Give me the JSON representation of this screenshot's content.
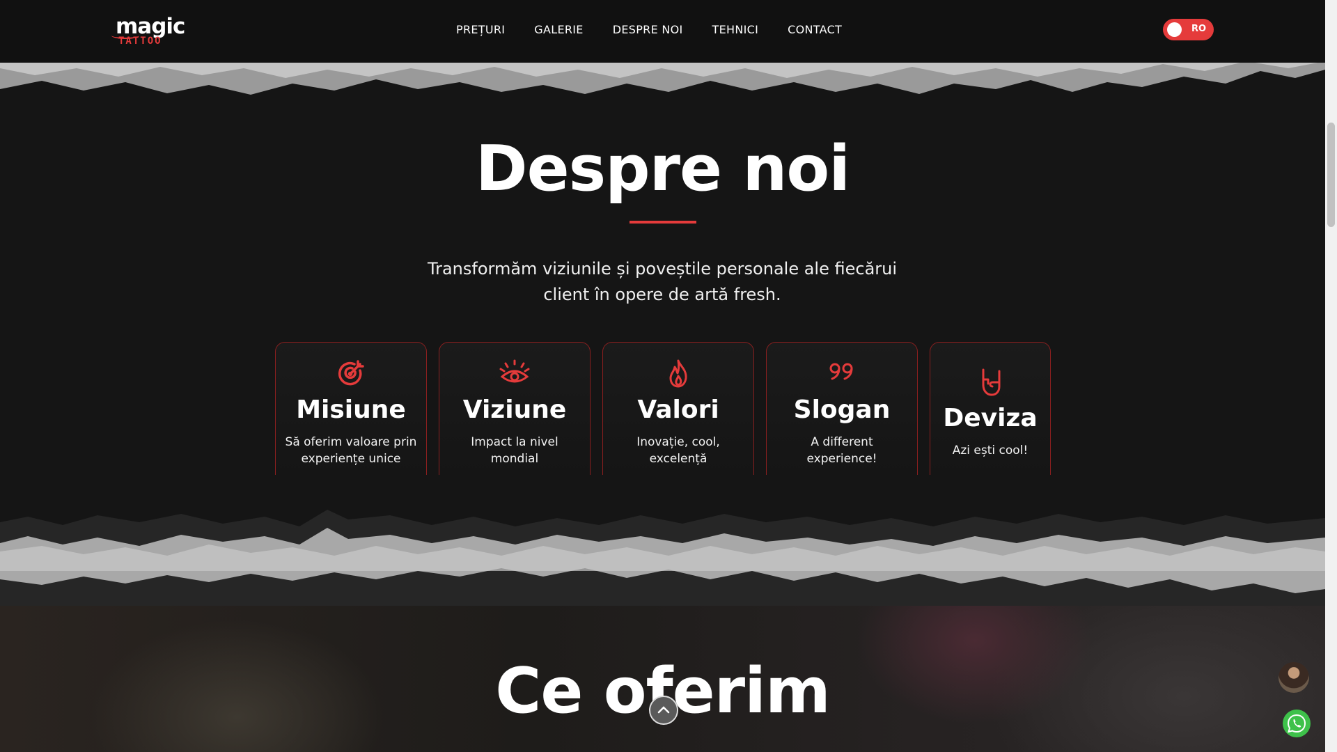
{
  "brand": {
    "logo_word1": "magic",
    "logo_word2": "TATTOO"
  },
  "nav": {
    "items": [
      "PREȚURI",
      "GALERIE",
      "DESPRE NOI",
      "TEHNICI",
      "CONTACT"
    ]
  },
  "lang_toggle": {
    "label": "RO"
  },
  "about": {
    "title": "Despre noi",
    "subtitle_line1": "Transformăm viziunile și poveștile personale ale fiecărui",
    "subtitle_line2": "client în opere de artă fresh.",
    "cards": [
      {
        "title": "Misiune",
        "text": "Să oferim valoare prin experiențe unice",
        "icon": "target-icon"
      },
      {
        "title": "Viziune",
        "text": "Impact la nivel mondial",
        "icon": "eye-icon"
      },
      {
        "title": "Valori",
        "text": "Inovație, cool, excelență",
        "icon": "flame-icon"
      },
      {
        "title": "Slogan",
        "text": "A different experience!",
        "icon": "quote-icon"
      },
      {
        "title": "Deviza",
        "text": "Azi ești cool!",
        "icon": "rock-hand-icon"
      }
    ]
  },
  "offer": {
    "title": "Ce oferim"
  },
  "colors": {
    "accent": "#e53b3b",
    "background": "#151515",
    "whatsapp": "#3ec14a"
  }
}
